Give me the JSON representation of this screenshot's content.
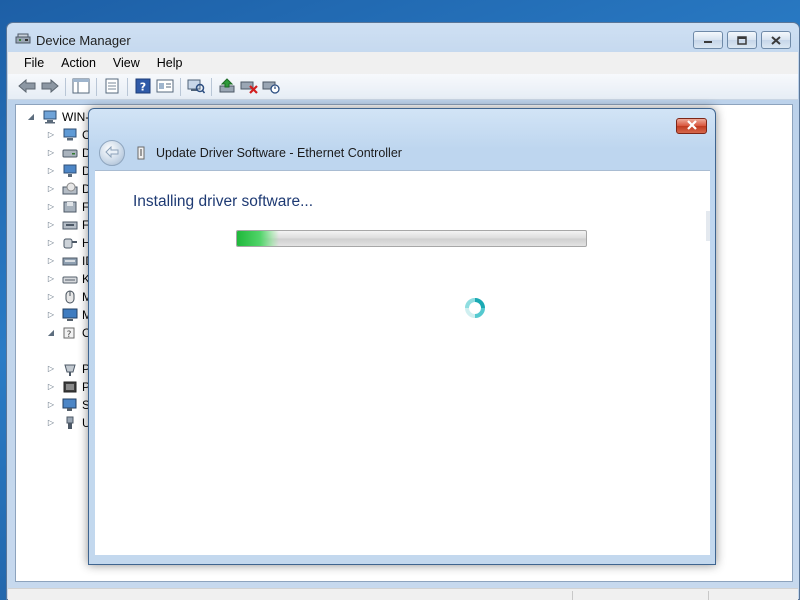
{
  "window": {
    "title": "Device Manager",
    "icon": "device-manager-icon",
    "minimize_icon": "minimize-icon",
    "maximize_icon": "maximize-icon",
    "close_icon": "close-icon"
  },
  "menu": [
    "File",
    "Action",
    "View",
    "Help"
  ],
  "toolbar": {
    "buttons": [
      "back-arrow-icon",
      "forward-arrow-icon",
      "show-hide-console-tree-icon",
      "properties-icon",
      "help-icon",
      "view-details-icon",
      "scan-hardware-icon",
      "update-driver-icon",
      "uninstall-device-icon",
      "disable-device-icon"
    ]
  },
  "tree": {
    "root": "WIN-I",
    "items": [
      {
        "label": "Co",
        "icon": "computer-icon",
        "expander": "▷"
      },
      {
        "label": "Di",
        "icon": "disk-drive-icon",
        "expander": "▷"
      },
      {
        "label": "Di",
        "icon": "display-adapter-icon",
        "expander": "▷"
      },
      {
        "label": "DV",
        "icon": "dvd-drive-icon",
        "expander": "▷"
      },
      {
        "label": "Fl",
        "icon": "floppy-controller-icon",
        "expander": "▷"
      },
      {
        "label": "Fl",
        "icon": "floppy-drive-icon",
        "expander": "▷"
      },
      {
        "label": "Hu",
        "icon": "hid-device-icon",
        "expander": "▷"
      },
      {
        "label": "ID",
        "icon": "ide-controller-icon",
        "expander": "▷"
      },
      {
        "label": "Ke",
        "icon": "keyboard-icon",
        "expander": "▷"
      },
      {
        "label": "M",
        "icon": "mouse-icon",
        "expander": "▷"
      },
      {
        "label": "M",
        "icon": "monitor-icon",
        "expander": "▷"
      },
      {
        "label": "Ot",
        "icon": "other-devices-icon",
        "expander": "◢"
      },
      {
        "label": "",
        "icon": "unknown-device-warning-icon",
        "expander": ""
      },
      {
        "label": "Po",
        "icon": "ports-icon",
        "expander": "▷"
      },
      {
        "label": "Pr",
        "icon": "processor-icon",
        "expander": "▷"
      },
      {
        "label": "Sy",
        "icon": "system-devices-icon",
        "expander": "▷"
      },
      {
        "label": "Ur",
        "icon": "usb-controller-icon",
        "expander": "▷"
      }
    ]
  },
  "dialog": {
    "title": "Update Driver Software - Ethernet Controller",
    "heading": "Installing driver software...",
    "progress_fraction": 0.12,
    "back_icon": "back-arrow-icon",
    "title_icon": "ethernet-device-icon",
    "close_icon": "close-icon",
    "spinner_icon": "busy-spinner-icon"
  },
  "colors": {
    "heading": "#1e3a73",
    "progress": "#1fb83b",
    "close_button": "#c8432a",
    "desktop": "#2a7cc6"
  }
}
